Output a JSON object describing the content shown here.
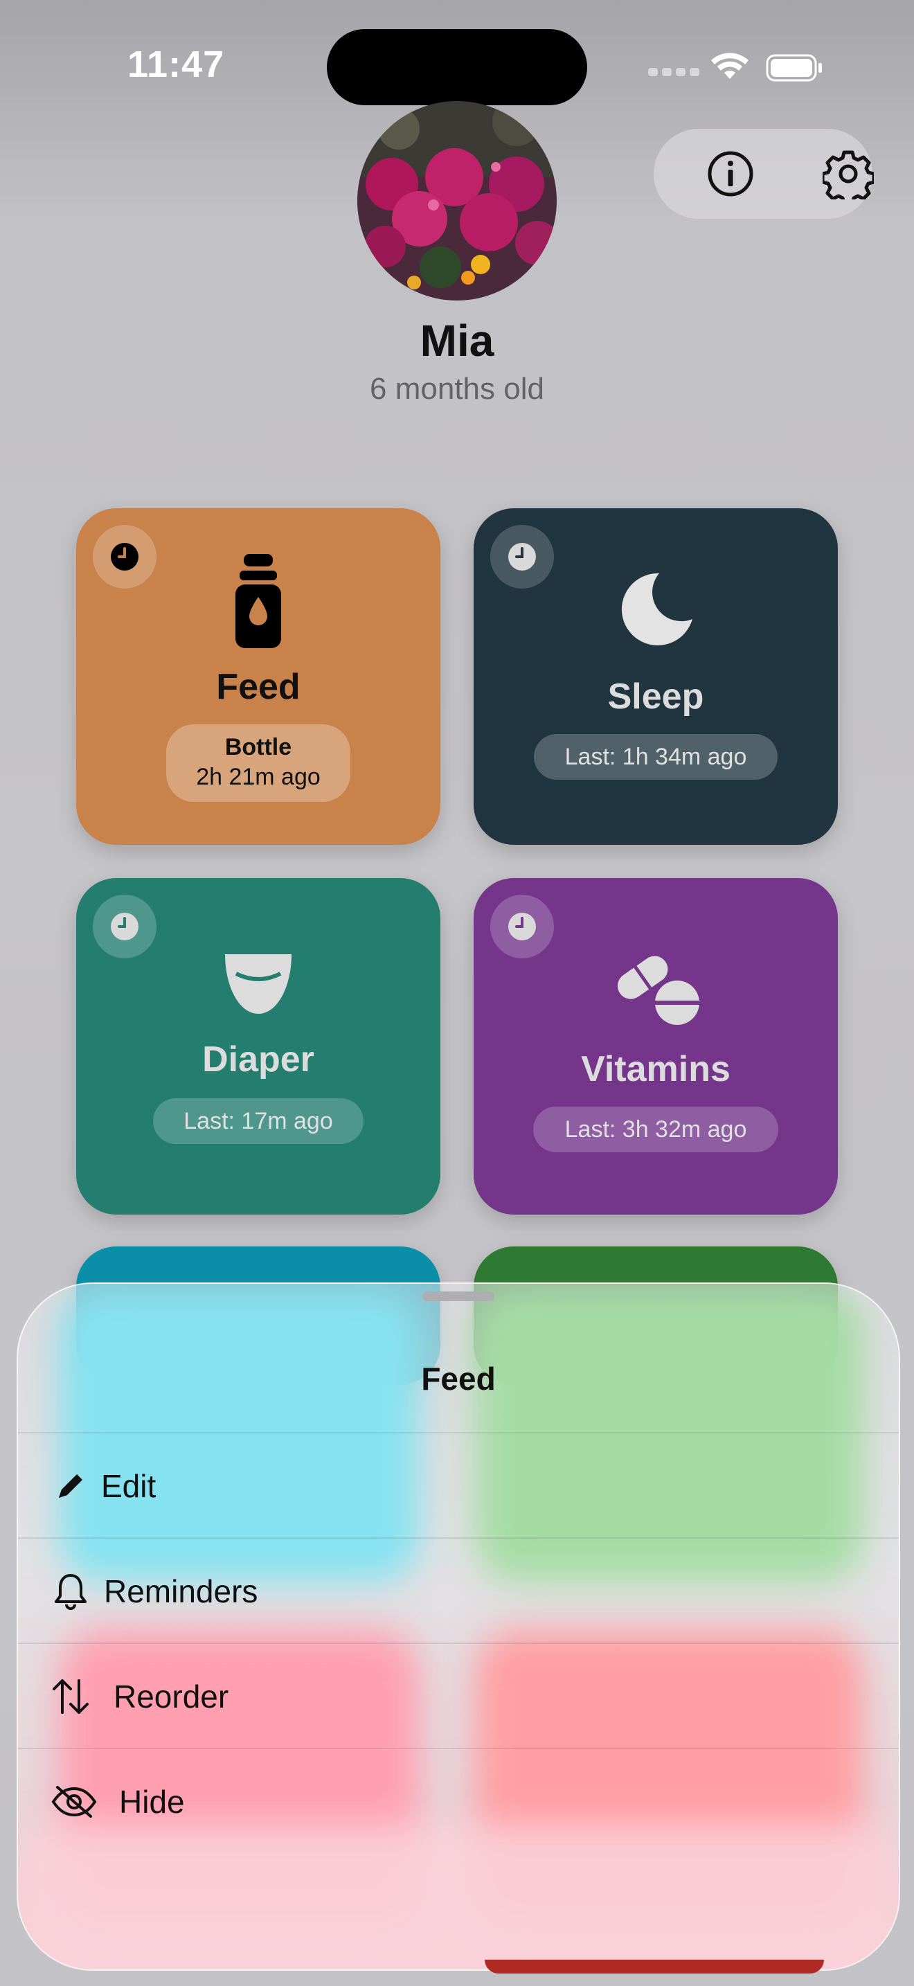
{
  "status_bar": {
    "time": "11:47"
  },
  "header": {
    "info_icon": "info-icon",
    "settings_icon": "gear-icon"
  },
  "profile": {
    "name": "Mia",
    "age": "6 months old"
  },
  "tiles": [
    {
      "title": "Feed",
      "pill_title": "Bottle",
      "pill_text": "2h 21m ago",
      "color": "#c8824a",
      "icon": "bottle-icon"
    },
    {
      "title": "Sleep",
      "pill_text": "Last: 1h 34m ago",
      "color": "#203540",
      "icon": "moon-icon"
    },
    {
      "title": "Diaper",
      "pill_text": "Last: 17m ago",
      "color": "#237e70",
      "icon": "diaper-icon"
    },
    {
      "title": "Vitamins",
      "pill_text": "Last: 3h 32m ago",
      "color": "#74358b",
      "icon": "pills-icon"
    }
  ],
  "sheet": {
    "title": "Feed",
    "items": [
      {
        "label": "Edit",
        "icon": "pencil-icon"
      },
      {
        "label": "Reminders",
        "icon": "bell-icon"
      },
      {
        "label": "Reorder",
        "icon": "arrow-up-down-icon"
      },
      {
        "label": "Hide",
        "icon": "eye-slash-icon"
      }
    ]
  }
}
